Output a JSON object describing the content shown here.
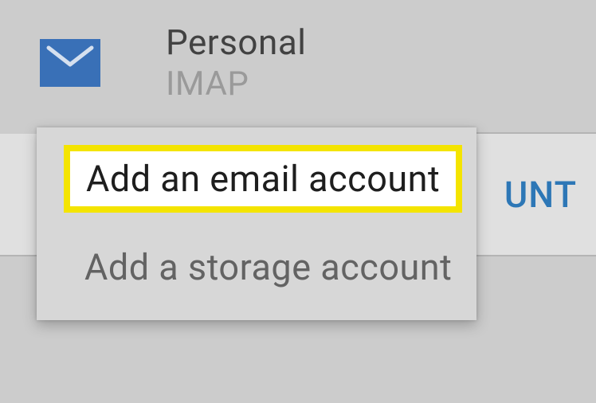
{
  "account": {
    "name": "Personal",
    "type": "IMAP",
    "icon": "mail-icon"
  },
  "action_button": {
    "label_fragment": "UNT"
  },
  "popup": {
    "items": [
      {
        "label": "Add an email account",
        "highlighted": true
      },
      {
        "label": "Add a storage account",
        "highlighted": false
      }
    ]
  },
  "colors": {
    "mail_icon_bg": "#3970b7",
    "accent": "#2d77b6",
    "highlight_border": "#f4e400",
    "highlight_bg": "#ffffff"
  }
}
